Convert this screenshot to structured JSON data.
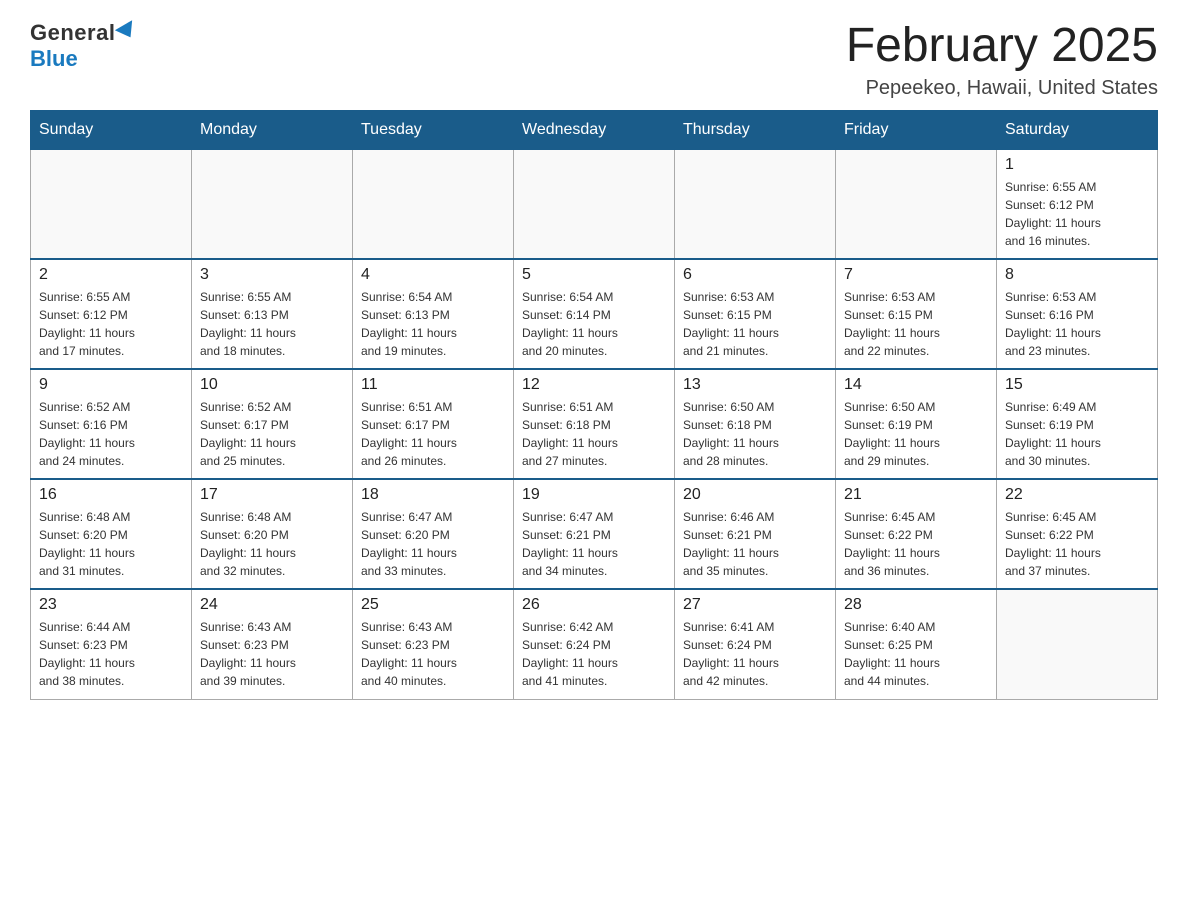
{
  "logo": {
    "general": "General",
    "blue": "Blue"
  },
  "title": "February 2025",
  "location": "Pepeekeo, Hawaii, United States",
  "weekdays": [
    "Sunday",
    "Monday",
    "Tuesday",
    "Wednesday",
    "Thursday",
    "Friday",
    "Saturday"
  ],
  "weeks": [
    [
      {
        "day": "",
        "info": ""
      },
      {
        "day": "",
        "info": ""
      },
      {
        "day": "",
        "info": ""
      },
      {
        "day": "",
        "info": ""
      },
      {
        "day": "",
        "info": ""
      },
      {
        "day": "",
        "info": ""
      },
      {
        "day": "1",
        "info": "Sunrise: 6:55 AM\nSunset: 6:12 PM\nDaylight: 11 hours\nand 16 minutes."
      }
    ],
    [
      {
        "day": "2",
        "info": "Sunrise: 6:55 AM\nSunset: 6:12 PM\nDaylight: 11 hours\nand 17 minutes."
      },
      {
        "day": "3",
        "info": "Sunrise: 6:55 AM\nSunset: 6:13 PM\nDaylight: 11 hours\nand 18 minutes."
      },
      {
        "day": "4",
        "info": "Sunrise: 6:54 AM\nSunset: 6:13 PM\nDaylight: 11 hours\nand 19 minutes."
      },
      {
        "day": "5",
        "info": "Sunrise: 6:54 AM\nSunset: 6:14 PM\nDaylight: 11 hours\nand 20 minutes."
      },
      {
        "day": "6",
        "info": "Sunrise: 6:53 AM\nSunset: 6:15 PM\nDaylight: 11 hours\nand 21 minutes."
      },
      {
        "day": "7",
        "info": "Sunrise: 6:53 AM\nSunset: 6:15 PM\nDaylight: 11 hours\nand 22 minutes."
      },
      {
        "day": "8",
        "info": "Sunrise: 6:53 AM\nSunset: 6:16 PM\nDaylight: 11 hours\nand 23 minutes."
      }
    ],
    [
      {
        "day": "9",
        "info": "Sunrise: 6:52 AM\nSunset: 6:16 PM\nDaylight: 11 hours\nand 24 minutes."
      },
      {
        "day": "10",
        "info": "Sunrise: 6:52 AM\nSunset: 6:17 PM\nDaylight: 11 hours\nand 25 minutes."
      },
      {
        "day": "11",
        "info": "Sunrise: 6:51 AM\nSunset: 6:17 PM\nDaylight: 11 hours\nand 26 minutes."
      },
      {
        "day": "12",
        "info": "Sunrise: 6:51 AM\nSunset: 6:18 PM\nDaylight: 11 hours\nand 27 minutes."
      },
      {
        "day": "13",
        "info": "Sunrise: 6:50 AM\nSunset: 6:18 PM\nDaylight: 11 hours\nand 28 minutes."
      },
      {
        "day": "14",
        "info": "Sunrise: 6:50 AM\nSunset: 6:19 PM\nDaylight: 11 hours\nand 29 minutes."
      },
      {
        "day": "15",
        "info": "Sunrise: 6:49 AM\nSunset: 6:19 PM\nDaylight: 11 hours\nand 30 minutes."
      }
    ],
    [
      {
        "day": "16",
        "info": "Sunrise: 6:48 AM\nSunset: 6:20 PM\nDaylight: 11 hours\nand 31 minutes."
      },
      {
        "day": "17",
        "info": "Sunrise: 6:48 AM\nSunset: 6:20 PM\nDaylight: 11 hours\nand 32 minutes."
      },
      {
        "day": "18",
        "info": "Sunrise: 6:47 AM\nSunset: 6:20 PM\nDaylight: 11 hours\nand 33 minutes."
      },
      {
        "day": "19",
        "info": "Sunrise: 6:47 AM\nSunset: 6:21 PM\nDaylight: 11 hours\nand 34 minutes."
      },
      {
        "day": "20",
        "info": "Sunrise: 6:46 AM\nSunset: 6:21 PM\nDaylight: 11 hours\nand 35 minutes."
      },
      {
        "day": "21",
        "info": "Sunrise: 6:45 AM\nSunset: 6:22 PM\nDaylight: 11 hours\nand 36 minutes."
      },
      {
        "day": "22",
        "info": "Sunrise: 6:45 AM\nSunset: 6:22 PM\nDaylight: 11 hours\nand 37 minutes."
      }
    ],
    [
      {
        "day": "23",
        "info": "Sunrise: 6:44 AM\nSunset: 6:23 PM\nDaylight: 11 hours\nand 38 minutes."
      },
      {
        "day": "24",
        "info": "Sunrise: 6:43 AM\nSunset: 6:23 PM\nDaylight: 11 hours\nand 39 minutes."
      },
      {
        "day": "25",
        "info": "Sunrise: 6:43 AM\nSunset: 6:23 PM\nDaylight: 11 hours\nand 40 minutes."
      },
      {
        "day": "26",
        "info": "Sunrise: 6:42 AM\nSunset: 6:24 PM\nDaylight: 11 hours\nand 41 minutes."
      },
      {
        "day": "27",
        "info": "Sunrise: 6:41 AM\nSunset: 6:24 PM\nDaylight: 11 hours\nand 42 minutes."
      },
      {
        "day": "28",
        "info": "Sunrise: 6:40 AM\nSunset: 6:25 PM\nDaylight: 11 hours\nand 44 minutes."
      },
      {
        "day": "",
        "info": ""
      }
    ]
  ]
}
